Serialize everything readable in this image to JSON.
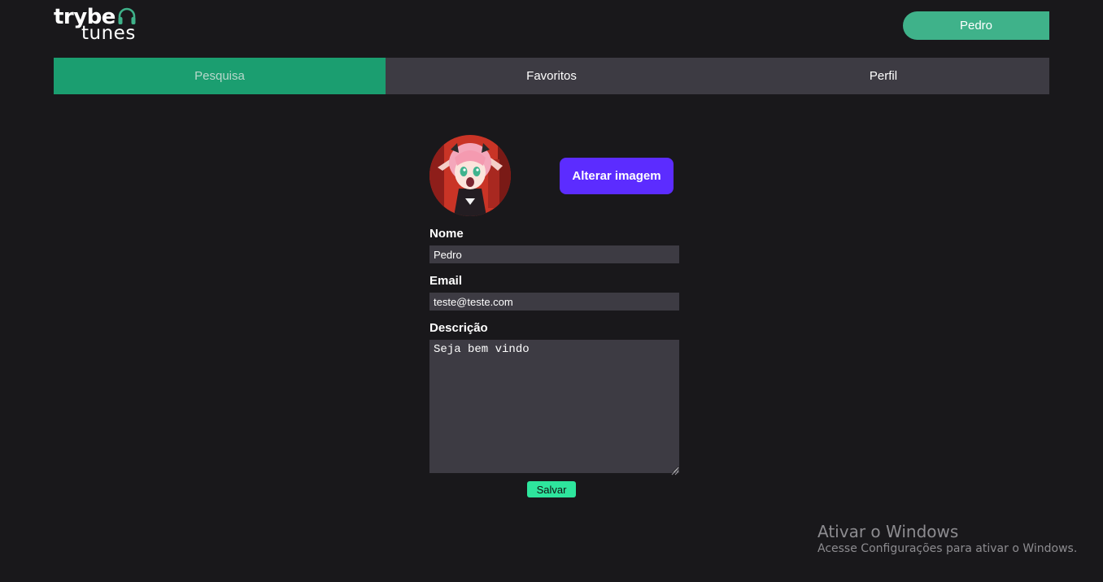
{
  "app": {
    "logo_top": "trybe",
    "logo_bottom": "tunes",
    "logo_icon": "headphones-icon",
    "accent_color": "#1b9e70"
  },
  "header": {
    "user_name": "Pedro"
  },
  "nav": {
    "tabs": [
      {
        "label": "Pesquisa",
        "active": true
      },
      {
        "label": "Favoritos",
        "active": false
      },
      {
        "label": "Perfil",
        "active": false
      }
    ]
  },
  "profile": {
    "avatar": "profile-avatar-image",
    "change_image_label": "Alterar imagem",
    "name_label": "Nome",
    "name_value": "Pedro",
    "email_label": "Email",
    "email_value": "teste@teste.com",
    "description_label": "Descrição",
    "description_value": "Seja bem vindo",
    "save_label": "Salvar"
  },
  "watermark": {
    "title": "Ativar o Windows",
    "subtitle": "Acesse Configurações para ativar o Windows."
  }
}
